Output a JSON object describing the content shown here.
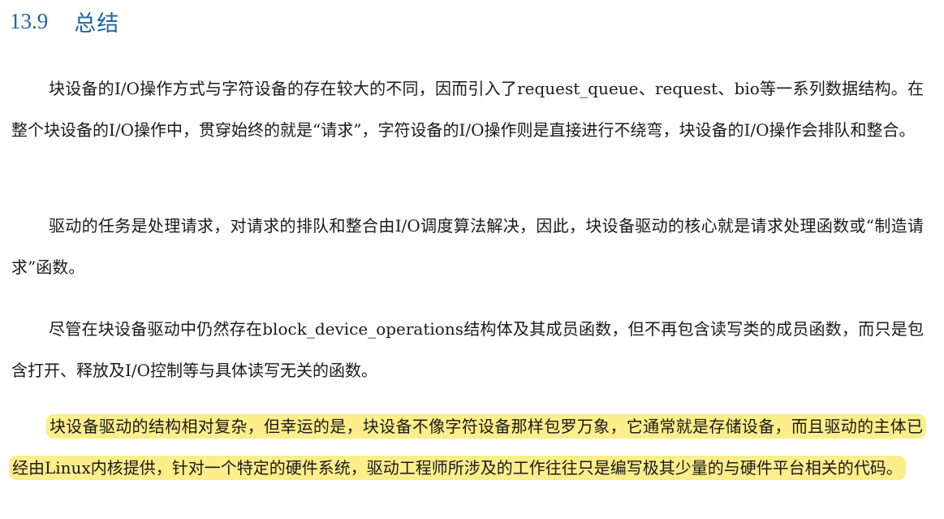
{
  "heading": {
    "number": "13.9",
    "title": "总结"
  },
  "paragraphs": [
    "块设备的I/O操作方式与字符设备的存在较大的不同，因而引入了request_queue、request、bio等一系列数据结构。在整个块设备的I/O操作中，贯穿始终的就是“请求”，字符设备的I/O操作则是直接进行不绕弯，块设备的I/O操作会排队和整合。",
    "驱动的任务是处理请求，对请求的排队和整合由I/O调度算法解决，因此，块设备驱动的核心就是请求处理函数或“制造请求”函数。",
    "尽管在块设备驱动中仍然存在block_device_operations结构体及其成员函数，但不再包含读写类的成员函数，而只是包含打开、释放及I/O控制等与具体读写无关的函数。",
    "块设备驱动的结构相对复杂，但幸运的是，块设备不像字符设备那样包罗万象，它通常就是存储设备，而且驱动的主体已经由Linux内核提供，针对一个特定的硬件系统，驱动工程师所涉及的工作往往只是编写极其少量的与硬件平台相关的代码。"
  ],
  "highlight": {
    "paragraph_index": 3,
    "color": "#fcee8a"
  },
  "colors": {
    "heading": "#1f62a8",
    "text": "#1a1a1a",
    "background": "#ffffff"
  }
}
